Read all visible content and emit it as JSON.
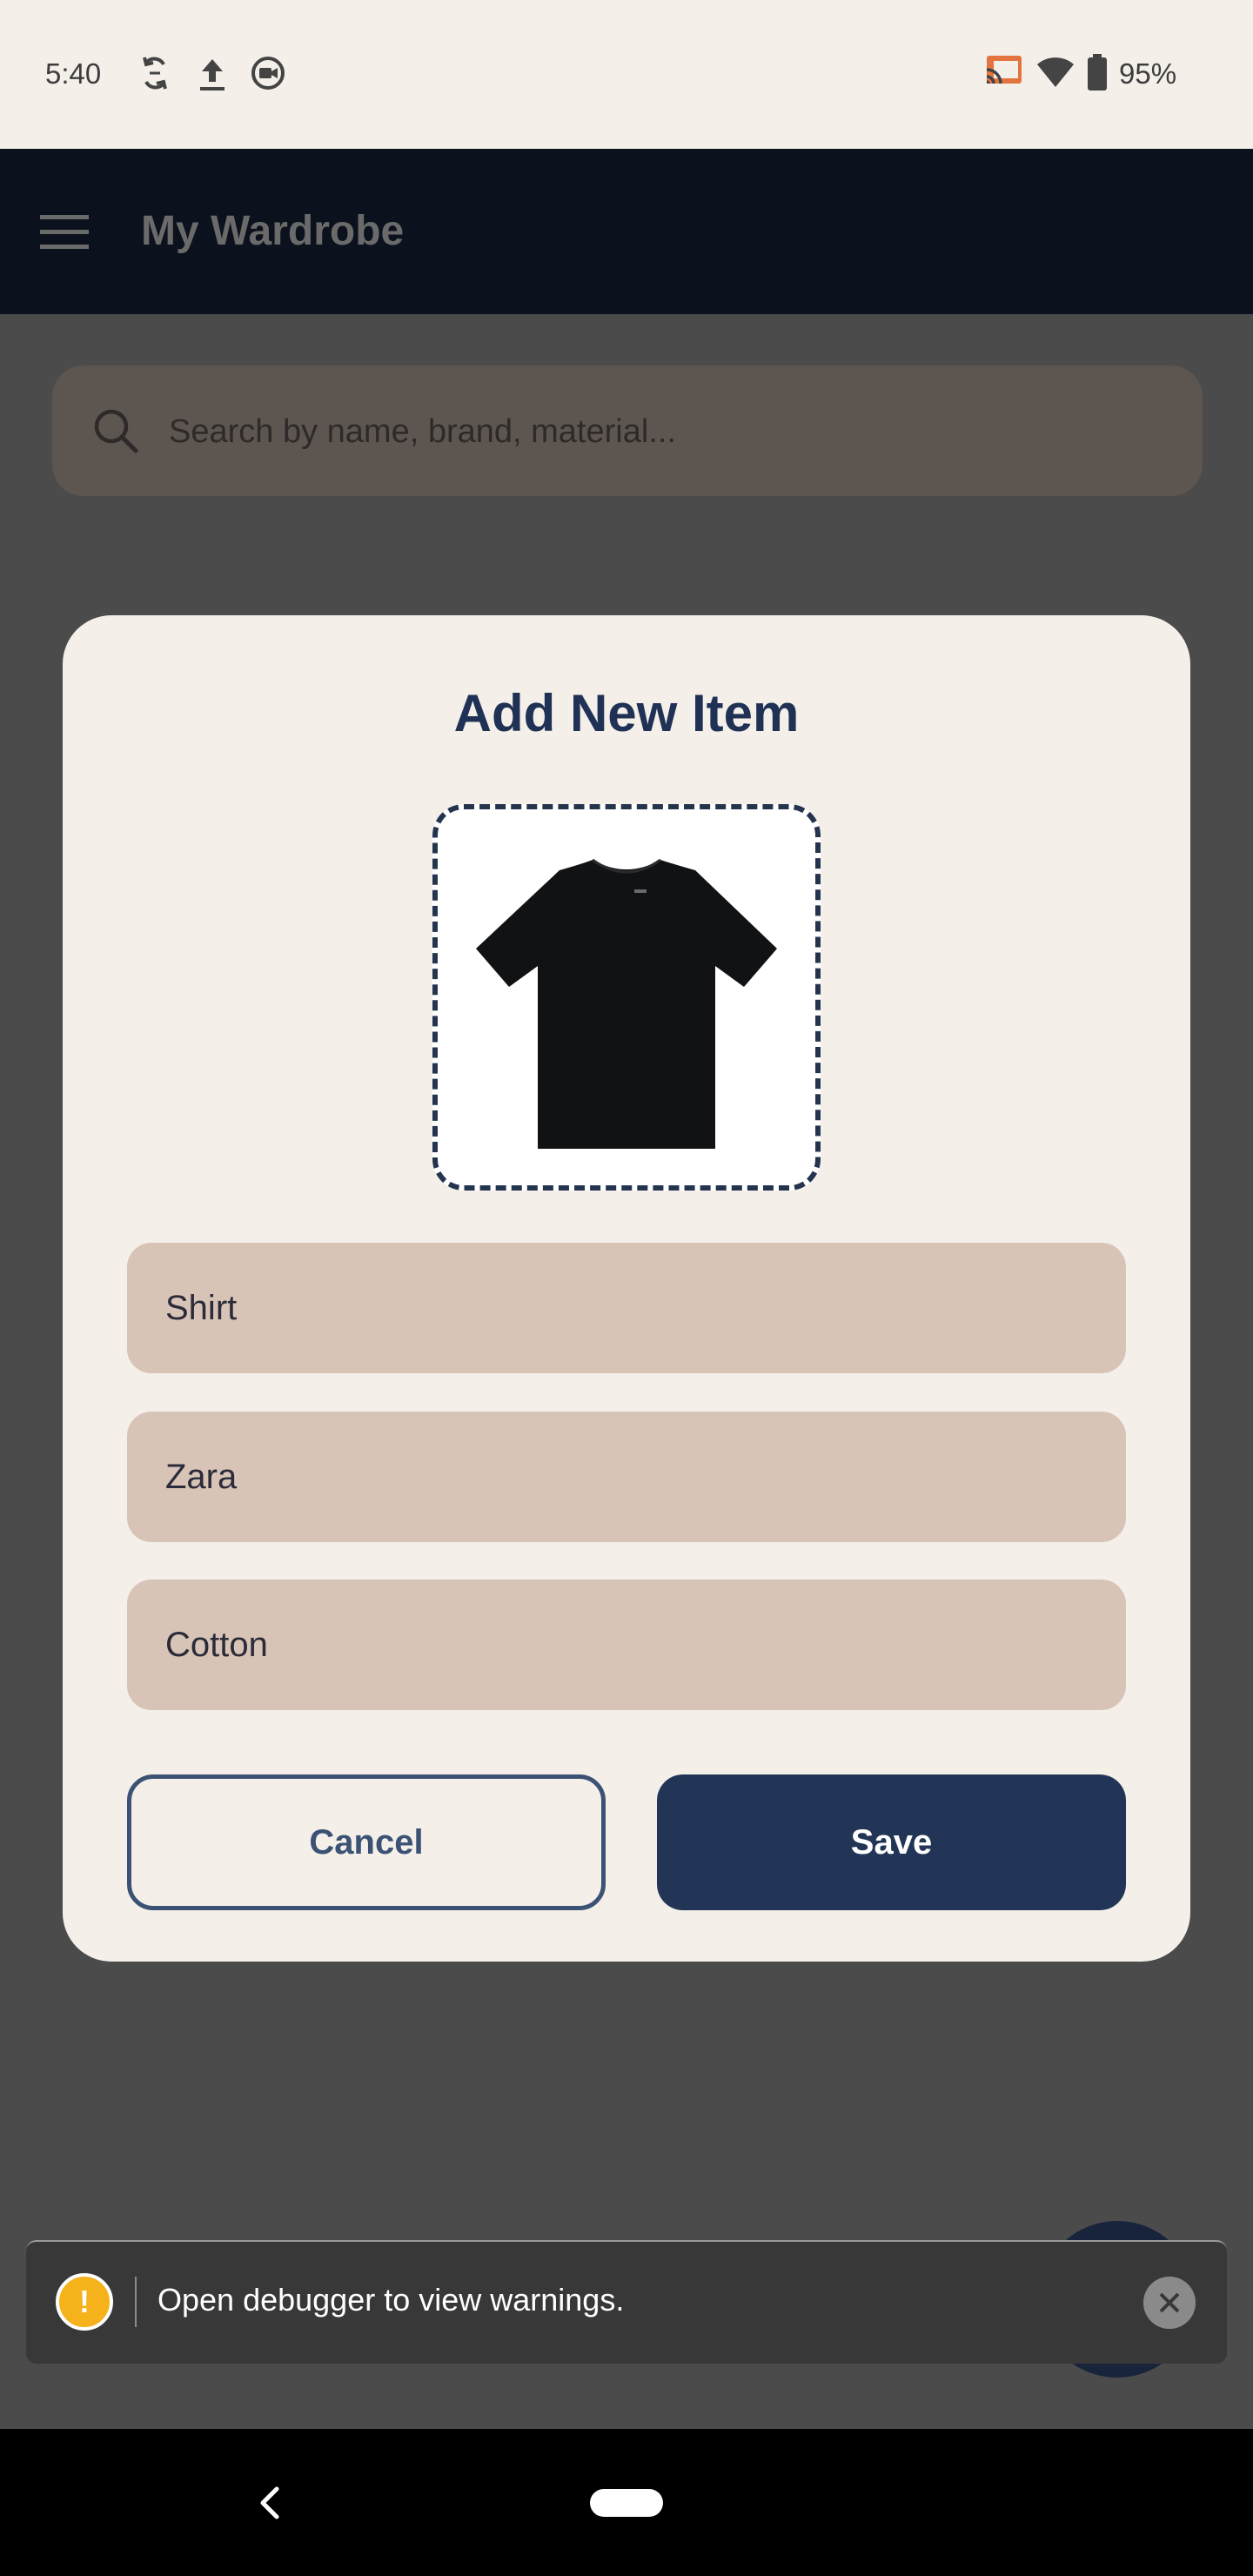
{
  "status_bar": {
    "time": "5:40",
    "battery": "95%",
    "icons": [
      "sync-icon",
      "upload-icon",
      "screen-record-icon",
      "cast-icon",
      "wifi-icon",
      "battery-icon"
    ]
  },
  "app_bar": {
    "title": "My Wardrobe",
    "menu_icon": "hamburger-menu-icon"
  },
  "search": {
    "placeholder": "Search by name, brand, material..."
  },
  "dialog": {
    "title": "Add New Item",
    "image": "black-tshirt-image",
    "fields": {
      "name": "Shirt",
      "brand": "Zara",
      "material": "Cotton"
    },
    "cancel_label": "Cancel",
    "save_label": "Save"
  },
  "toast": {
    "icon_text": "!",
    "message": "Open debugger to view warnings."
  },
  "colors": {
    "primary_navy": "#223556",
    "dialog_bg": "#f4efe9",
    "field_bg": "#d8c4b7",
    "warning": "#f5b21a"
  }
}
